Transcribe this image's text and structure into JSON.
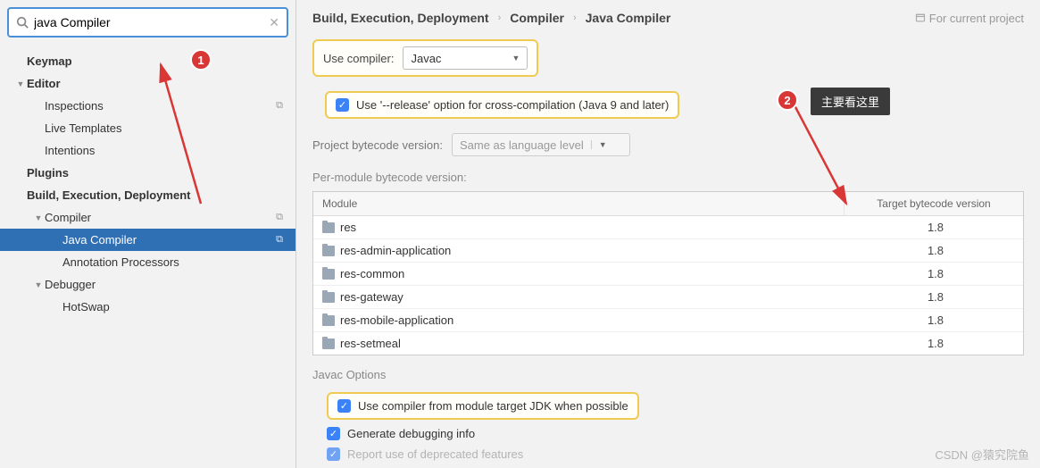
{
  "search": {
    "value": "java Compiler",
    "placeholder": ""
  },
  "tree": [
    {
      "label": "Keymap",
      "depth": 0,
      "arrow": "",
      "bold": true,
      "dup": false,
      "selected": false
    },
    {
      "label": "Editor",
      "depth": 0,
      "arrow": "▼",
      "bold": true,
      "dup": false,
      "selected": false
    },
    {
      "label": "Inspections",
      "depth": 1,
      "arrow": "",
      "bold": false,
      "dup": true,
      "selected": false
    },
    {
      "label": "Live Templates",
      "depth": 1,
      "arrow": "",
      "bold": false,
      "dup": false,
      "selected": false
    },
    {
      "label": "Intentions",
      "depth": 1,
      "arrow": "",
      "bold": false,
      "dup": false,
      "selected": false
    },
    {
      "label": "Plugins",
      "depth": 0,
      "arrow": "",
      "bold": true,
      "dup": false,
      "selected": false
    },
    {
      "label": "Build, Execution, Deployment",
      "depth": 0,
      "arrow": "",
      "bold": true,
      "dup": false,
      "selected": false
    },
    {
      "label": "Compiler",
      "depth": 1,
      "arrow": "▼",
      "bold": false,
      "dup": true,
      "selected": false
    },
    {
      "label": "Java Compiler",
      "depth": 2,
      "arrow": "",
      "bold": false,
      "dup": true,
      "selected": true
    },
    {
      "label": "Annotation Processors",
      "depth": 2,
      "arrow": "",
      "bold": false,
      "dup": false,
      "selected": false
    },
    {
      "label": "Debugger",
      "depth": 1,
      "arrow": "▼",
      "bold": false,
      "dup": false,
      "selected": false
    },
    {
      "label": "HotSwap",
      "depth": 2,
      "arrow": "",
      "bold": false,
      "dup": false,
      "selected": false
    }
  ],
  "breadcrumbs": [
    "Build, Execution, Deployment",
    "Compiler",
    "Java Compiler"
  ],
  "scope_text": "For current project",
  "use_compiler_label": "Use compiler:",
  "use_compiler_value": "Javac",
  "release_option_label": "Use '--release' option for cross-compilation (Java 9 and later)",
  "project_bytecode_label": "Project bytecode version:",
  "project_bytecode_value": "Same as language level",
  "per_module_label": "Per-module bytecode version:",
  "table": {
    "col_module": "Module",
    "col_version": "Target bytecode version",
    "rows": [
      {
        "module": "res",
        "version": "1.8"
      },
      {
        "module": "res-admin-application",
        "version": "1.8"
      },
      {
        "module": "res-common",
        "version": "1.8"
      },
      {
        "module": "res-gateway",
        "version": "1.8"
      },
      {
        "module": "res-mobile-application",
        "version": "1.8"
      },
      {
        "module": "res-setmeal",
        "version": "1.8"
      }
    ]
  },
  "javac_options_label": "Javac Options",
  "opt_module_jdk": "Use compiler from module target JDK when possible",
  "opt_debug": "Generate debugging info",
  "opt_deprecated": "Report use of deprecated features",
  "badges": {
    "b1": "1",
    "b2": "2"
  },
  "tooltip_text": "主要看这里",
  "watermark": "CSDN @猿究院鱼"
}
